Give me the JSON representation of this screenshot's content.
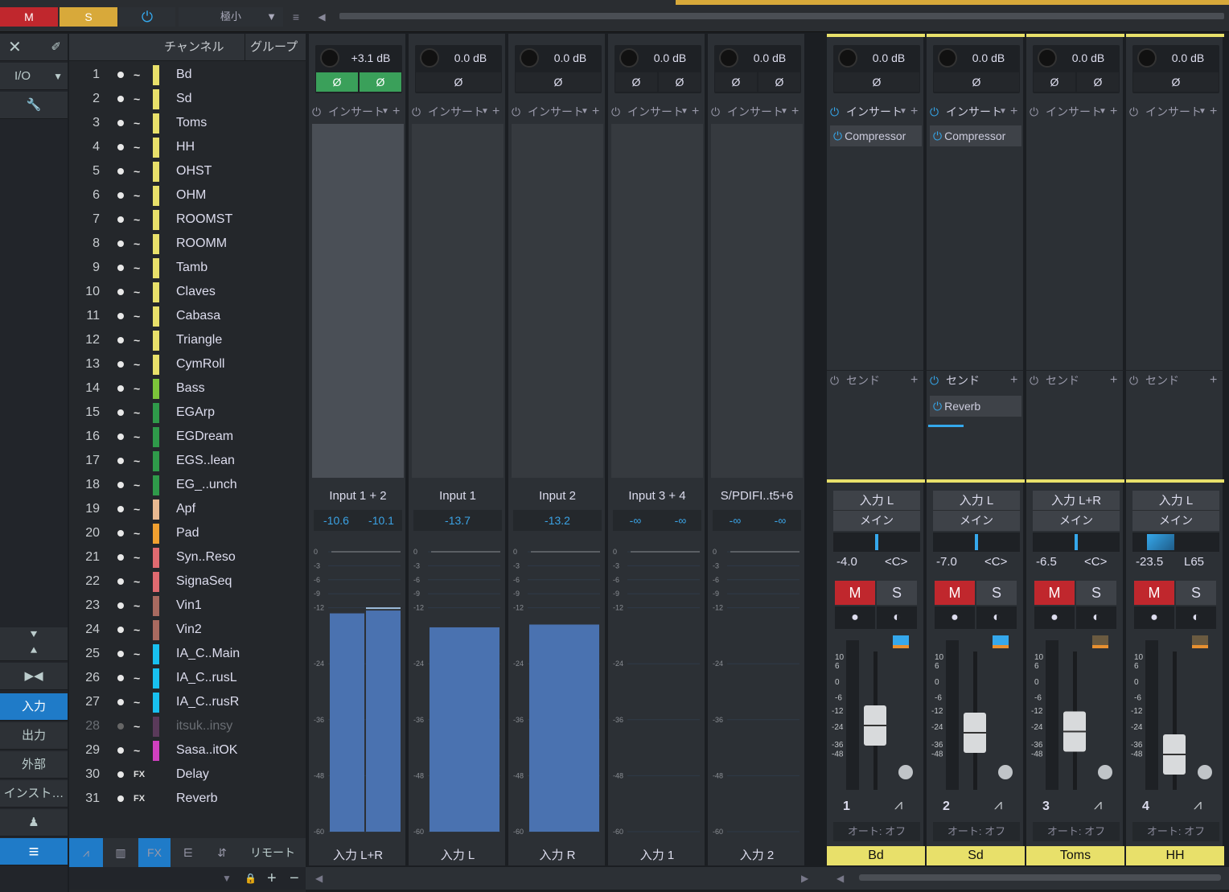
{
  "topbar": {
    "mute": "M",
    "solo": "S",
    "power": "⏻",
    "size": "極小",
    "chevron": "▼"
  },
  "lefttools": {
    "close": "✕",
    "pin": "✐",
    "io": "I/O",
    "io_chevron": "▼",
    "wrench": "🔧",
    "down_up": "⯆",
    "up": "⯅",
    "expand": "▶◀",
    "nav": [
      "入力",
      "出力",
      "外部",
      "インスト…"
    ],
    "people": "♟",
    "list": "≡"
  },
  "chlist": {
    "head_channel": "チャンネル",
    "head_group": "グループ",
    "rows": [
      {
        "num": "1",
        "name": "Bd",
        "color": "#e8e06a",
        "wave": "~"
      },
      {
        "num": "2",
        "name": "Sd",
        "color": "#e8e06a",
        "wave": "~"
      },
      {
        "num": "3",
        "name": "Toms",
        "color": "#e8e06a",
        "wave": "~"
      },
      {
        "num": "4",
        "name": "HH",
        "color": "#e8e06a",
        "wave": "~"
      },
      {
        "num": "5",
        "name": "OHST",
        "color": "#e8e06a",
        "wave": "~"
      },
      {
        "num": "6",
        "name": "OHM",
        "color": "#e8e06a",
        "wave": "~"
      },
      {
        "num": "7",
        "name": "ROOMST",
        "color": "#e8e06a",
        "wave": "~"
      },
      {
        "num": "8",
        "name": "ROOMM",
        "color": "#e8e06a",
        "wave": "~"
      },
      {
        "num": "9",
        "name": "Tamb",
        "color": "#e8e06a",
        "wave": "~"
      },
      {
        "num": "10",
        "name": "Claves",
        "color": "#e8e06a",
        "wave": "~"
      },
      {
        "num": "11",
        "name": "Cabasa",
        "color": "#e8e06a",
        "wave": "~"
      },
      {
        "num": "12",
        "name": "Triangle",
        "color": "#e8e06a",
        "wave": "~"
      },
      {
        "num": "13",
        "name": "CymRoll",
        "color": "#e8e06a",
        "wave": "~"
      },
      {
        "num": "14",
        "name": "Bass",
        "color": "#7cc53a",
        "wave": "~"
      },
      {
        "num": "15",
        "name": "EGArp",
        "color": "#2f9a4a",
        "wave": "~"
      },
      {
        "num": "16",
        "name": "EGDream",
        "color": "#2f9a4a",
        "wave": "~"
      },
      {
        "num": "17",
        "name": "EGS..lean",
        "color": "#2f9a4a",
        "wave": "~"
      },
      {
        "num": "18",
        "name": "EG_..unch",
        "color": "#2f9a4a",
        "wave": "~"
      },
      {
        "num": "19",
        "name": "Apf",
        "color": "#e8b890",
        "wave": "~"
      },
      {
        "num": "20",
        "name": "Pad",
        "color": "#f0a030",
        "wave": "~"
      },
      {
        "num": "21",
        "name": "Syn..Reso",
        "color": "#e06a70",
        "wave": "~"
      },
      {
        "num": "22",
        "name": "SignaSeq",
        "color": "#e06a70",
        "wave": "~"
      },
      {
        "num": "23",
        "name": "Vin1",
        "color": "#a86a60",
        "wave": "~"
      },
      {
        "num": "24",
        "name": "Vin2",
        "color": "#a86a60",
        "wave": "~"
      },
      {
        "num": "25",
        "name": "IA_C..Main",
        "color": "#18c0f0",
        "wave": "~"
      },
      {
        "num": "26",
        "name": "IA_C..rusL",
        "color": "#18c0f0",
        "wave": "~"
      },
      {
        "num": "27",
        "name": "IA_C..rusR",
        "color": "#18c0f0",
        "wave": "~"
      },
      {
        "num": "28",
        "name": "itsuk..insy",
        "color": "#5a3a5a",
        "wave": "~"
      },
      {
        "num": "29",
        "name": "Sasa..itOK",
        "color": "#d040c0",
        "wave": "~"
      },
      {
        "num": "30",
        "name": "Delay",
        "color": "",
        "wave": "FX"
      },
      {
        "num": "31",
        "name": "Reverb",
        "color": "",
        "wave": "FX"
      }
    ],
    "footer": [
      "⩘",
      "▥",
      "FX",
      "⋿",
      "⇵",
      "リモート"
    ],
    "bottom": [
      "▼",
      "🔒",
      "+",
      "−"
    ]
  },
  "inputs": [
    {
      "gain": "+3.1 dB",
      "phase": [
        "Ø",
        "Ø"
      ],
      "insert": "インサート",
      "name": "Input 1 + 2",
      "peaks": [
        "-10.6",
        "-10.1"
      ],
      "bottom": "入力 L+R",
      "levels": [
        0.78,
        0.79
      ]
    },
    {
      "gain": "0.0 dB",
      "phase": [
        "Ø"
      ],
      "insert": "インサート",
      "name": "Input 1",
      "peaks": [
        "-13.7"
      ],
      "bottom": "入力 L",
      "levels": [
        0.73
      ]
    },
    {
      "gain": "0.0 dB",
      "phase": [
        "Ø"
      ],
      "insert": "インサート",
      "name": "Input 2",
      "peaks": [
        "-13.2"
      ],
      "bottom": "入力 R",
      "levels": [
        0.74
      ]
    },
    {
      "gain": "0.0 dB",
      "phase": [
        "Ø",
        "Ø"
      ],
      "insert": "インサート",
      "name": "Input 3 + 4",
      "peaks": [
        "-∞",
        "-∞"
      ],
      "bottom": "入力 1",
      "levels": [
        0
      ]
    },
    {
      "gain": "0.0 dB",
      "phase": [
        "Ø",
        "Ø"
      ],
      "insert": "インサート",
      "name": "S/PDIFI..t5+6",
      "peaks": [
        "-∞",
        "-∞"
      ],
      "bottom": "入力 2",
      "levels": [
        0
      ]
    }
  ],
  "meter_ticks": [
    "0",
    "-3",
    "-6",
    "-9",
    "-12",
    "-24",
    "-36",
    "-48",
    "-60"
  ],
  "channels": [
    {
      "gain": "0.0 dB",
      "phase": [
        "Ø"
      ],
      "insert": "インサート",
      "plugin": "Compressor",
      "send": "センド",
      "sendplugin": "",
      "route1": "入力 L",
      "route2": "メイン",
      "pan": "-4.0",
      "panpos": "<C>",
      "num": "1",
      "auto": "オート: オフ",
      "name": "Bd",
      "fader": 0.62
    },
    {
      "gain": "0.0 dB",
      "phase": [
        "Ø"
      ],
      "insert": "インサート",
      "plugin": "Compressor",
      "send": "センド",
      "sendplugin": "Reverb",
      "route1": "入力 L",
      "route2": "メイン",
      "pan": "-7.0",
      "panpos": "<C>",
      "num": "2",
      "auto": "オート: オフ",
      "name": "Sd",
      "fader": 0.56
    },
    {
      "gain": "0.0 dB",
      "phase": [
        "Ø",
        "Ø"
      ],
      "insert": "インサート",
      "plugin": "",
      "send": "センド",
      "sendplugin": "",
      "route1": "入力 L+R",
      "route2": "メイン",
      "pan": "-6.5",
      "panpos": "<C>",
      "num": "3",
      "auto": "オート: オフ",
      "name": "Toms",
      "fader": 0.57
    },
    {
      "gain": "0.0 dB",
      "phase": [
        "Ø"
      ],
      "insert": "インサート",
      "plugin": "",
      "send": "センド",
      "sendplugin": "",
      "route1": "入力 L",
      "route2": "メイン",
      "pan": "-23.5",
      "panpos": "L65",
      "num": "4",
      "auto": "オート: オフ",
      "name": "HH",
      "fader": 0.38
    }
  ],
  "fader_ticks": [
    "10",
    "6",
    "0",
    "-6",
    "-12",
    "-24",
    "-36",
    "-48"
  ],
  "labels": {
    "mute": "M",
    "solo": "S"
  }
}
